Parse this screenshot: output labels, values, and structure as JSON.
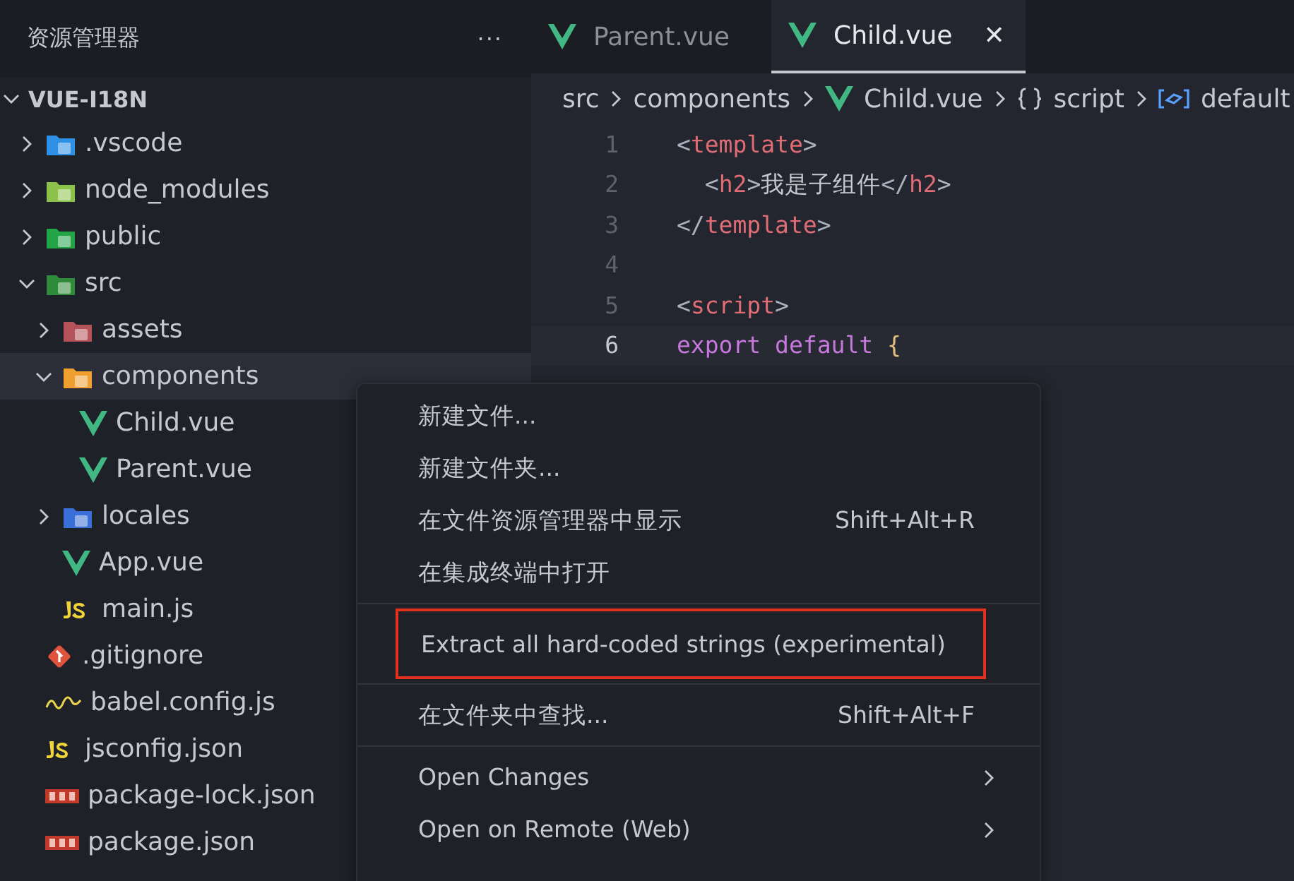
{
  "sidebar": {
    "title": "资源管理器",
    "more": "···",
    "root": {
      "label": "VUE-I18N",
      "expanded": true
    },
    "tree": [
      {
        "label": ".vscode",
        "kind": "folder",
        "color": "#2d8fe6",
        "expanded": false,
        "selected": false
      },
      {
        "label": "node_modules",
        "kind": "folder",
        "color": "#8bc34a",
        "expanded": false,
        "selected": false
      },
      {
        "label": "public",
        "kind": "folder",
        "color": "#22a447",
        "expanded": false,
        "selected": false
      },
      {
        "label": "src",
        "kind": "folder",
        "color": "#2e8b3a",
        "expanded": true,
        "selected": false,
        "children": [
          {
            "label": "assets",
            "kind": "folder",
            "color": "#b5525a",
            "expanded": false,
            "selected": false
          },
          {
            "label": "components",
            "kind": "folder",
            "color": "#f0a030",
            "expanded": true,
            "selected": true,
            "children": [
              {
                "label": "Child.vue",
                "kind": "vue",
                "selected": false
              },
              {
                "label": "Parent.vue",
                "kind": "vue",
                "selected": false
              }
            ]
          },
          {
            "label": "locales",
            "kind": "folder",
            "color": "#3b6fd8",
            "expanded": false,
            "selected": false
          },
          {
            "label": "App.vue",
            "kind": "vue",
            "selected": false
          },
          {
            "label": "main.js",
            "kind": "js",
            "selected": false
          }
        ]
      },
      {
        "label": ".gitignore",
        "kind": "git",
        "selected": false
      },
      {
        "label": "babel.config.js",
        "kind": "babel",
        "selected": false
      },
      {
        "label": "jsconfig.json",
        "kind": "js",
        "selected": false
      },
      {
        "label": "package-lock.json",
        "kind": "npm",
        "selected": false
      },
      {
        "label": "package.json",
        "kind": "npm",
        "selected": false
      }
    ]
  },
  "tabs": [
    {
      "label": "Parent.vue",
      "selected": false
    },
    {
      "label": "Child.vue",
      "selected": true,
      "close": "✕"
    }
  ],
  "breadcrumbs": [
    {
      "label": "src",
      "kind": "folder"
    },
    {
      "label": "components",
      "kind": "folder"
    },
    {
      "label": "Child.vue",
      "kind": "vue"
    },
    {
      "label": "script",
      "kind": "module"
    },
    {
      "label": "default",
      "kind": "variable"
    }
  ],
  "code": [
    {
      "number": "1",
      "current": false,
      "tokens": [
        {
          "kind": "punct",
          "text": "<"
        },
        {
          "kind": "tag",
          "text": "template"
        },
        {
          "kind": "punct",
          "text": ">"
        }
      ]
    },
    {
      "number": "2",
      "current": false,
      "tokens": [
        {
          "kind": "punct",
          "text": "  <"
        },
        {
          "kind": "tag",
          "text": "h2"
        },
        {
          "kind": "punct",
          "text": ">"
        },
        {
          "kind": "text",
          "text": "我是子组件"
        },
        {
          "kind": "punct",
          "text": "</"
        },
        {
          "kind": "tag",
          "text": "h2"
        },
        {
          "kind": "punct",
          "text": ">"
        }
      ]
    },
    {
      "number": "3",
      "current": false,
      "tokens": [
        {
          "kind": "punct",
          "text": "</"
        },
        {
          "kind": "tag",
          "text": "template"
        },
        {
          "kind": "punct",
          "text": ">"
        }
      ]
    },
    {
      "number": "4",
      "current": false
    },
    {
      "number": "5",
      "current": false,
      "tokens": [
        {
          "kind": "punct",
          "text": "<"
        },
        {
          "kind": "tag",
          "text": "script"
        },
        {
          "kind": "punct",
          "text": ">"
        }
      ]
    },
    {
      "number": "6",
      "current": true,
      "tokens": [
        {
          "kind": "keyword",
          "text": "export default "
        },
        {
          "kind": "brace",
          "text": "{"
        }
      ]
    }
  ],
  "context_menu": [
    {
      "kind": "item",
      "label": "新建文件...",
      "highlighted": false
    },
    {
      "kind": "item",
      "label": "新建文件夹...",
      "highlighted": false
    },
    {
      "kind": "item",
      "label": "在文件资源管理器中显示",
      "shortcut": "Shift+Alt+R",
      "highlighted": false
    },
    {
      "kind": "item",
      "label": "在集成终端中打开",
      "highlighted": false
    },
    {
      "kind": "separator"
    },
    {
      "kind": "item",
      "label": "Extract all hard-coded strings (experimental)",
      "highlighted": true
    },
    {
      "kind": "separator"
    },
    {
      "kind": "item",
      "label": "在文件夹中查找...",
      "shortcut": "Shift+Alt+F",
      "highlighted": false
    },
    {
      "kind": "separator"
    },
    {
      "kind": "item",
      "label": "Open Changes",
      "submenu": true,
      "highlighted": false
    },
    {
      "kind": "item",
      "label": "Open on Remote (Web)",
      "submenu": true,
      "highlighted": false
    }
  ]
}
